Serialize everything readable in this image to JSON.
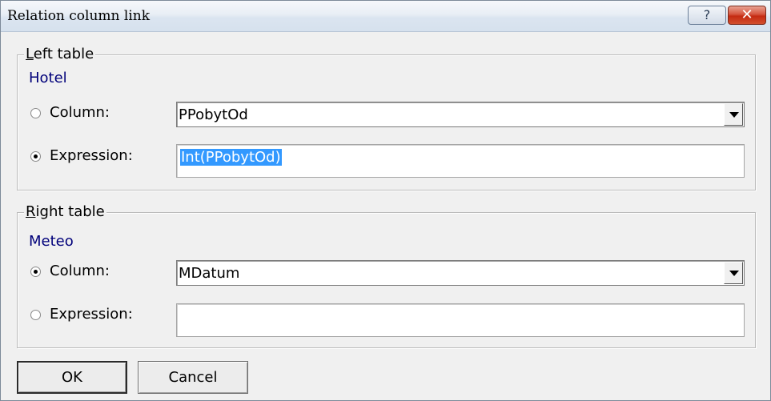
{
  "window": {
    "title": "Relation column link",
    "help_glyph": "?",
    "close_glyph": "✕"
  },
  "left": {
    "legend": "Left table",
    "table_name": "Hotel",
    "column_label": "Column:",
    "column_value": "PPobytOd",
    "expression_label": "Expression:",
    "expression_value": "Int(PPobytOd)",
    "selected": "expression"
  },
  "right": {
    "legend": "Right table",
    "table_name": "Meteo",
    "column_label": "Column:",
    "column_value": "MDatum",
    "expression_label": "Expression:",
    "expression_value": "",
    "selected": "column"
  },
  "buttons": {
    "ok": "OK",
    "cancel": "Cancel"
  },
  "icons": {
    "help": "help-icon",
    "close": "close-icon",
    "dropdown": "chevron-down-icon"
  }
}
